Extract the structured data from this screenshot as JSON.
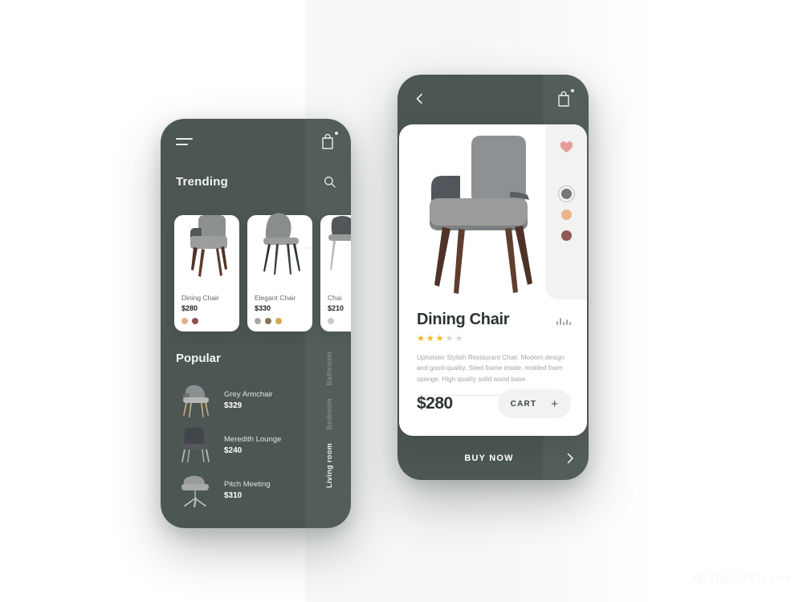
{
  "background": {
    "page_color": "#ffffff",
    "band_color": "#f6f7f7"
  },
  "watermark": {
    "text": "TODOPEN.com",
    "icon": "logo-icon"
  },
  "left_phone": {
    "theme_color": "#4c5653",
    "topbar": {
      "menu_icon": "hamburger-menu-icon",
      "bag_icon": "shopping-bag-icon",
      "bag_badge": true
    },
    "section_title": "Trending",
    "search_icon": "search-icon",
    "trending": [
      {
        "name": "Dining Chair",
        "price": "$280",
        "colors": [
          "#e0b089",
          "#8d4f4f"
        ]
      },
      {
        "name": "Elegant Chair",
        "price": "$330",
        "colors": [
          "#a9a9a6",
          "#8c7456",
          "#d7a84f"
        ]
      },
      {
        "name": "Chai",
        "price": "$210",
        "colors": [
          "#c7c9c8"
        ]
      }
    ],
    "popular_title": "Popular",
    "popular": [
      {
        "name": "Grey Armchair",
        "price": "$329"
      },
      {
        "name": "Meredith Lounge",
        "price": "$240"
      },
      {
        "name": "Pitch Meeting",
        "price": "$310"
      }
    ],
    "side_tabs": [
      {
        "label": "Bathroom",
        "active": false
      },
      {
        "label": "Bedroom",
        "active": false
      },
      {
        "label": "Living room",
        "active": true
      }
    ]
  },
  "right_phone": {
    "theme_color": "#4c5653",
    "topbar": {
      "back_icon": "back-chevron-icon",
      "bag_icon": "shopping-bag-icon",
      "bag_badge": true
    },
    "favorite_icon": "heart-icon",
    "favorite_color": "#e29a95",
    "swatches": [
      {
        "color": "#6e7270",
        "selected": true
      },
      {
        "color": "#eab185",
        "selected": false
      },
      {
        "color": "#8e5151",
        "selected": false
      }
    ],
    "product": {
      "name": "Dining Chair",
      "rating": 3,
      "rating_max": 5,
      "star_filled_color": "#f5b715",
      "star_empty_color": "#d5d7d6",
      "description": "Upholster Stylish Restaurant Chair. Modern design and good-quality. Steel frame inside, molded foam sponge. High quality solid wood base.",
      "price": "$280",
      "chart_icon": "equalizer-icon"
    },
    "cart_button": {
      "label": "CART",
      "plus": "+"
    },
    "buy_now": {
      "label": "BUY NOW",
      "chevron_icon": "forward-chevron-icon"
    }
  }
}
